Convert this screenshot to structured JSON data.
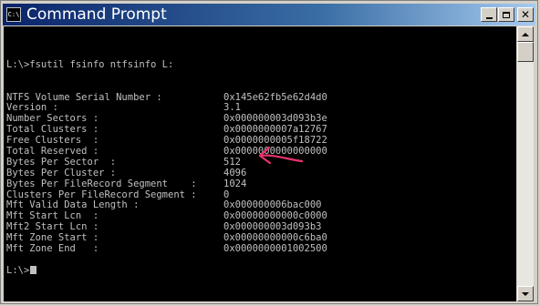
{
  "window": {
    "title": "Command Prompt",
    "icon_label": "C:\\"
  },
  "colors": {
    "console_background": "#000000",
    "console_text": "#c0c0c0",
    "title_bar": "#0a246a",
    "annotation_arrow": "#e8336a"
  },
  "console": {
    "command": "L:\\>fsutil fsinfo ntfsinfo L:",
    "rows": [
      {
        "label": "NTFS Volume Serial Number :",
        "value": "0x145e62fb5e62d4d0"
      },
      {
        "label": "Version :",
        "value": "3.1"
      },
      {
        "label": "Number Sectors :",
        "value": "0x000000003d093b3e"
      },
      {
        "label": "Total Clusters :",
        "value": "0x0000000007a12767"
      },
      {
        "label": "Free Clusters  :",
        "value": "0x0000000005f18722"
      },
      {
        "label": "Total Reserved :",
        "value": "0x0000000000000000"
      },
      {
        "label": "Bytes Per Sector  :",
        "value": "512"
      },
      {
        "label": "Bytes Per Cluster :",
        "value": "4096"
      },
      {
        "label": "Bytes Per FileRecord Segment    :",
        "value": "1024"
      },
      {
        "label": "Clusters Per FileRecord Segment :",
        "value": "0"
      },
      {
        "label": "Mft Valid Data Length :",
        "value": "0x000000006bac000"
      },
      {
        "label": "Mft Start Lcn  :",
        "value": "0x00000000000c0000"
      },
      {
        "label": "Mft2 Start Lcn :",
        "value": "0x000000003d093b3"
      },
      {
        "label": "Mft Zone Start :",
        "value": "0x00000000000c6ba0"
      },
      {
        "label": "Mft Zone End   :",
        "value": "0x0000000001002500"
      }
    ],
    "prompt": "L:\\>"
  },
  "icons": {
    "minimize": "minimize-icon",
    "maximize": "maximize-icon",
    "close": "close-icon",
    "scroll_up": "scroll-up-icon",
    "scroll_down": "scroll-down-icon"
  }
}
